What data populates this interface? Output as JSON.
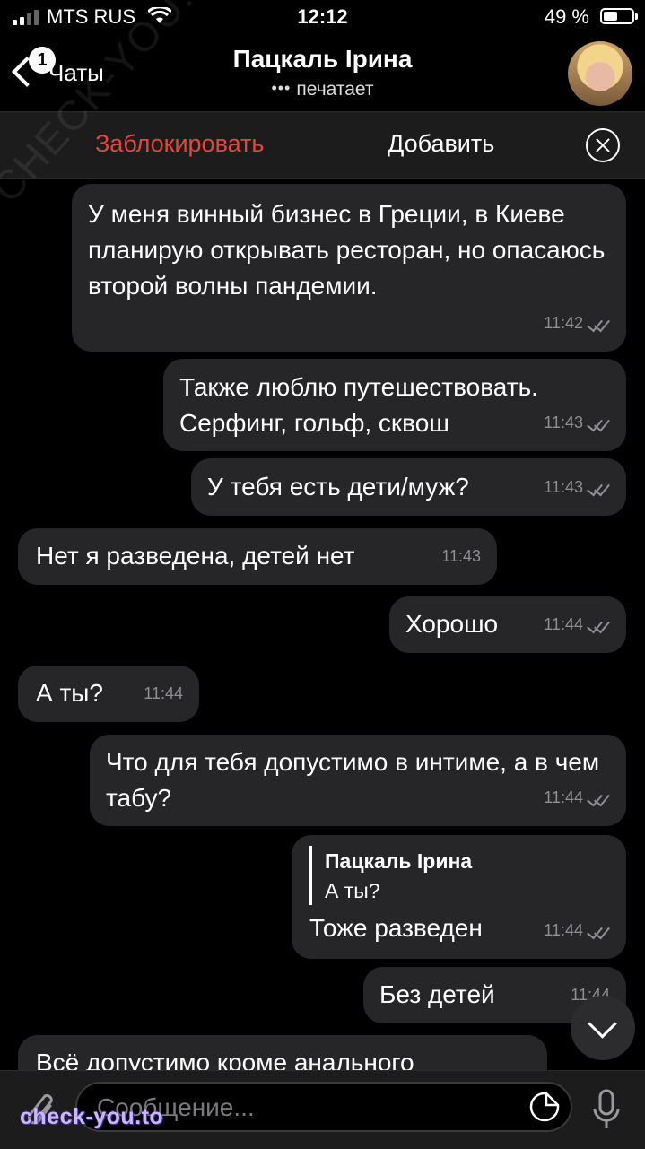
{
  "status_bar": {
    "carrier": "MTS RUS",
    "time": "12:12",
    "battery": "49 %",
    "battery_level": 0.49
  },
  "header": {
    "back_label": "Чаты",
    "unread_badge": "1",
    "title": "Пацкаль Ірина",
    "subtitle": "печатает"
  },
  "actions": {
    "block": "Заблокировать",
    "add": "Добавить"
  },
  "messages": [
    {
      "dir": "out",
      "text": "У меня винный бизнес в Греции, в Киеве планирую открывать ресторан, но опасаюсь второй волны пандемии.",
      "time": "11:42"
    },
    {
      "dir": "out",
      "text": "Также люблю путешествовать. Серфинг, гольф, сквош",
      "time": "11:43"
    },
    {
      "dir": "out",
      "text": "У тебя есть дети/муж?",
      "time": "11:43"
    },
    {
      "dir": "in",
      "text": "Нет я разведена, детей нет",
      "time": "11:43"
    },
    {
      "dir": "out",
      "text": "Хорошо",
      "time": "11:44"
    },
    {
      "dir": "in",
      "text": "А ты?",
      "time": "11:44"
    },
    {
      "dir": "out",
      "text": "Что для тебя допустимо в интиме, а в чем табу?",
      "time": "11:44"
    },
    {
      "dir": "out",
      "reply_name": "Пацкаль Ірина",
      "reply_text": "А ты?",
      "text": "Тоже разведен",
      "time": "11:44"
    },
    {
      "dir": "out",
      "text": "Без детей",
      "time": "11:44"
    },
    {
      "dir": "in",
      "text": "Всё допустимо кроме анального",
      "time": ""
    }
  ],
  "input": {
    "placeholder": "Сообщение..."
  },
  "watermarks": {
    "diagonal": "CHECK-YOU.ME",
    "brand": "check-you.to"
  },
  "colors": {
    "background": "#000000",
    "bubble": "#262628",
    "danger": "#e5453d",
    "meta": "#8e8e93"
  }
}
